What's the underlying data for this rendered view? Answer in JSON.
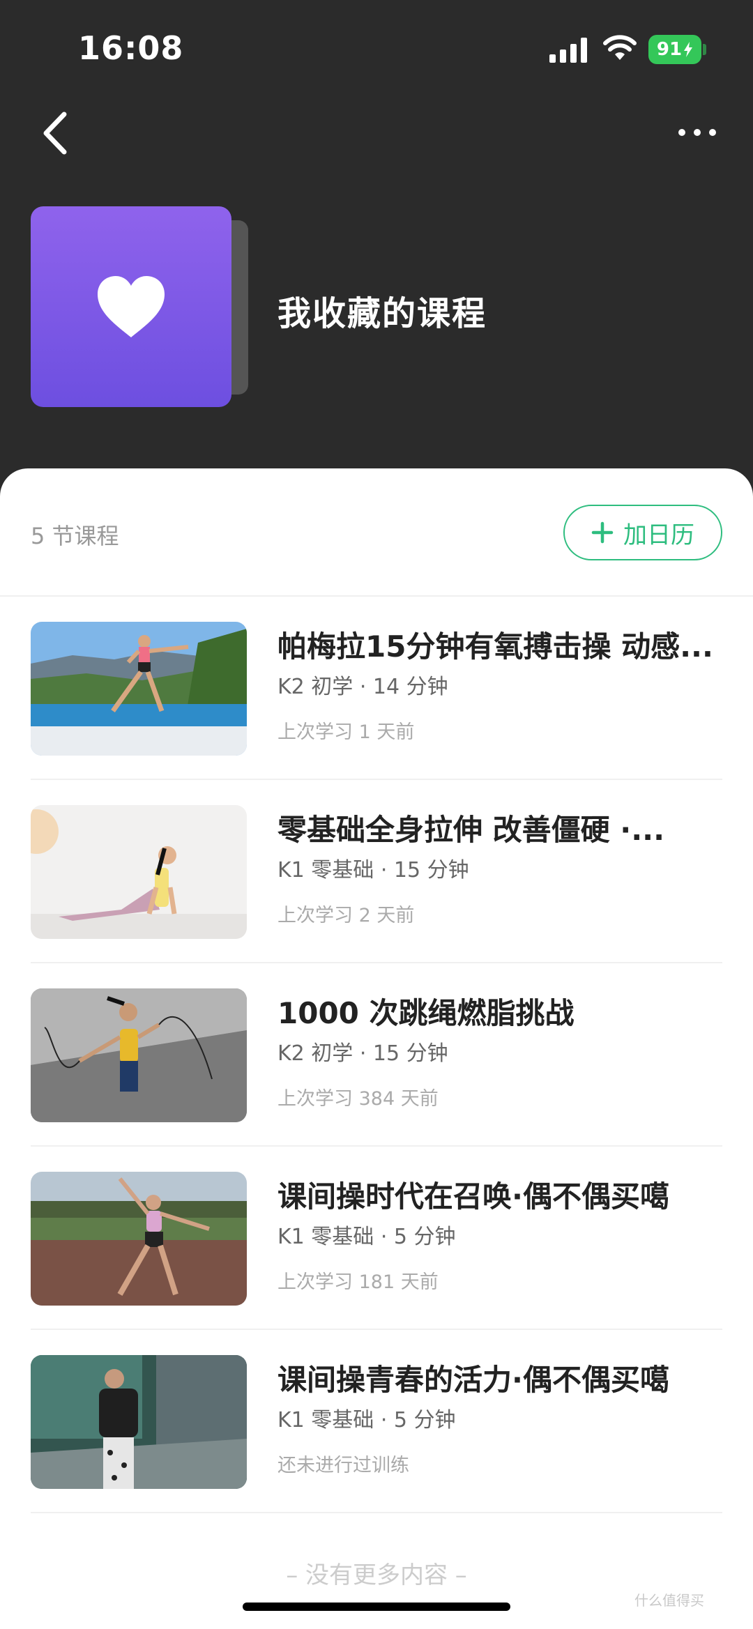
{
  "status_bar": {
    "time": "16:08",
    "battery_level": "91",
    "icons": [
      "signal-icon",
      "wifi-icon",
      "battery-icon",
      "charging-bolt-icon"
    ]
  },
  "nav": {
    "back_icon": "chevron-left-icon",
    "more_icon": "more-dots-icon"
  },
  "header": {
    "cover_icon": "heart-icon",
    "title": "我收藏的课程"
  },
  "colors": {
    "accent_green": "#2ebd7f",
    "cover_purple": "#7b57e6",
    "header_bg": "#2b2b2b"
  },
  "summary": {
    "count_label": "5 节课程",
    "calendar_button_label": "加日历",
    "calendar_icon": "plus-icon"
  },
  "courses": [
    {
      "title": "帕梅拉15分钟有氧搏击操 动感...",
      "meta": "K2 初学 · 14 分钟",
      "last_trained": "上次学习 1 天前",
      "thumbnail": "kickboxing-poolside-photo"
    },
    {
      "title": "零基础全身拉伸 改善僵硬 ·...",
      "meta": "K1 零基础 · 15 分钟",
      "last_trained": "上次学习 2 天前",
      "thumbnail": "yoga-cobra-stretch-photo"
    },
    {
      "title": "1000 次跳绳燃脂挑战",
      "meta": "K2 初学 · 15 分钟",
      "last_trained": "上次学习 384 天前",
      "thumbnail": "jump-rope-photo"
    },
    {
      "title": "课间操时代在召唤·偶不偶买噶",
      "meta": "K1 零基础 · 5 分钟",
      "last_trained": "上次学习 181 天前",
      "thumbnail": "sports-field-dance-photo"
    },
    {
      "title": "课间操青春的活力·偶不偶买噶",
      "meta": "K1 零基础 · 5 分钟",
      "last_trained": "还未进行过训练",
      "thumbnail": "street-dance-photo"
    }
  ],
  "footer": {
    "end_label": "– 没有更多内容 –",
    "watermark": "什么值得买"
  }
}
